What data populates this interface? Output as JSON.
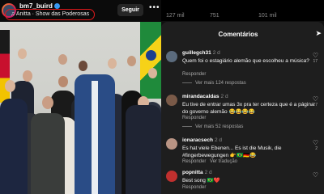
{
  "post": {
    "username": "bm7_buird",
    "music": "Anitta · Show das Poderosas",
    "follow_label": "Seguir",
    "more_glyph": "•••"
  },
  "top_stats": [
    "127 mil",
    "751",
    "101 mil"
  ],
  "comments_panel": {
    "title": "Comentários",
    "comments": [
      {
        "user": "guillegch31",
        "time": "2 d",
        "text": "Quem foi o estagiário alemão que escolheu a música?",
        "reply": "Responder",
        "more": "Ver mais 124 respostas",
        "likes": "17"
      },
      {
        "user": "mirandacaldas",
        "time": "2 d",
        "text": "Eu tive de entrar umas 3x pra ter certeza que é a página do governo alemão 😂😂😂😂",
        "reply": "Responder",
        "more": "Ver mais 52 respostas",
        "likes": "27"
      },
      {
        "user": "ionaracsech",
        "time": "2 d",
        "text": "Es hat viele Ebenen... Es ist die Musik, die #fingerbewegungen 👉🇧🇷🇩🇪😂",
        "reply": "Responder",
        "translate": "Ver tradução",
        "likes": "2"
      },
      {
        "user": "popnitta",
        "time": "2 d",
        "text": "Best song 🇧🇷❤️",
        "reply": "Responder",
        "likes": ""
      }
    ]
  },
  "colors": {
    "accent_red": "#e0191b",
    "verified_blue": "#3797f0"
  },
  "icons": [
    "music-note-icon",
    "verified-badge-icon",
    "more-dots-icon",
    "share-arrow-icon",
    "heart-icon"
  ]
}
